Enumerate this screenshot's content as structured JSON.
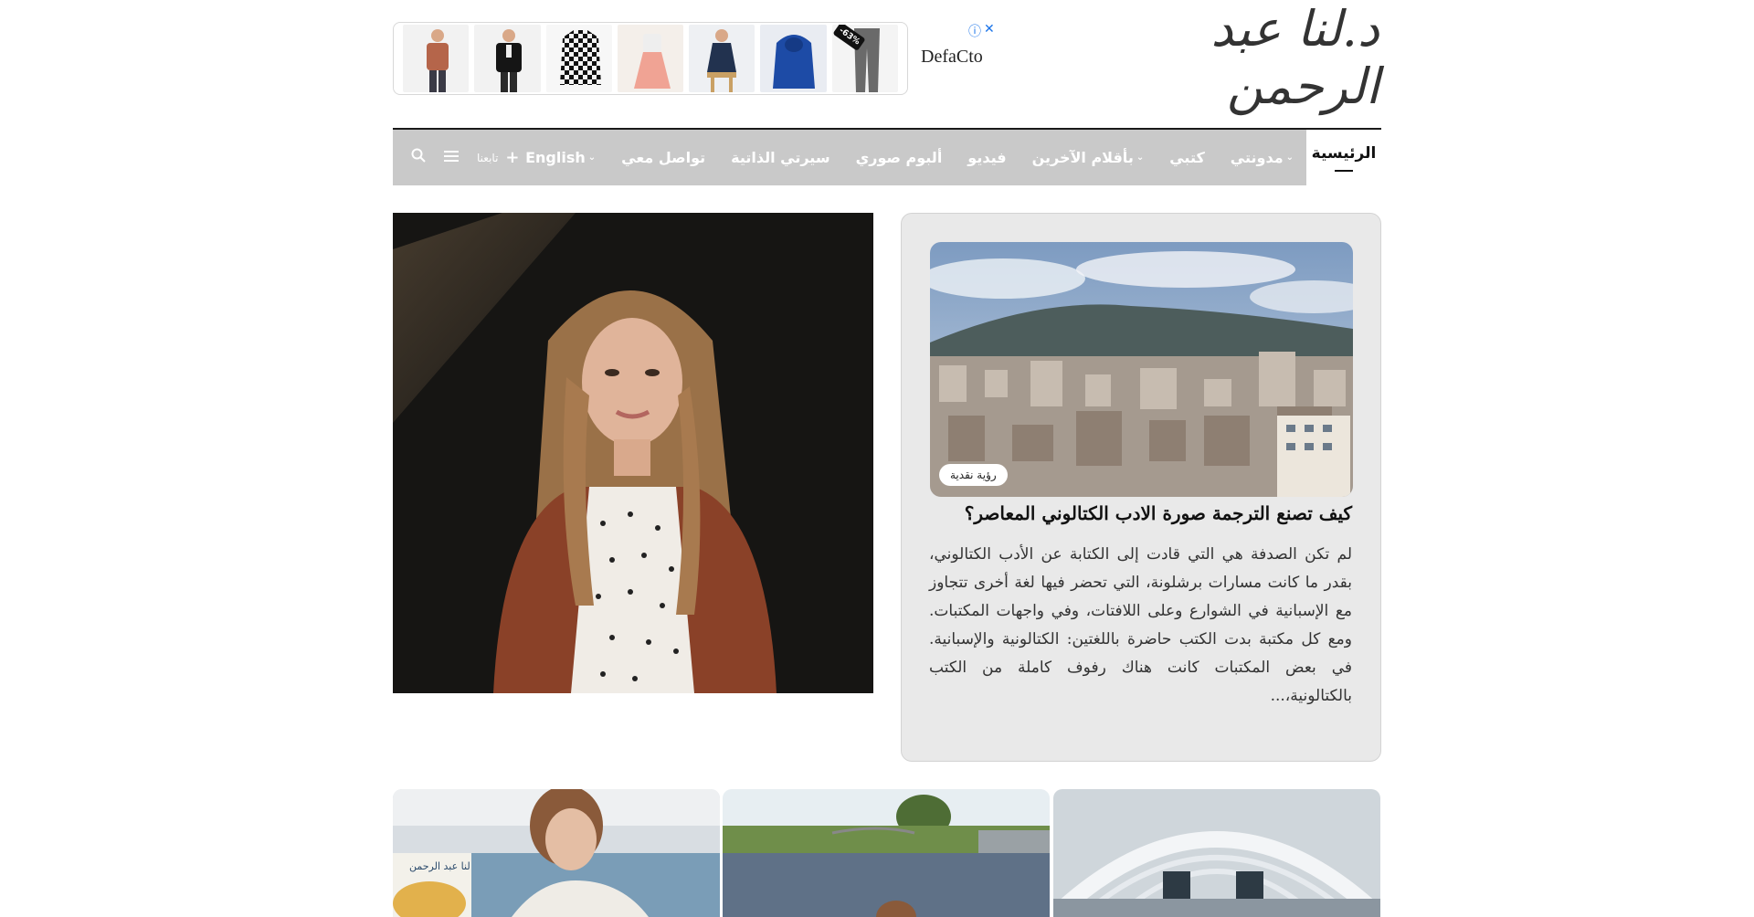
{
  "ad": {
    "brand": "DefaCto",
    "discount": "-63%",
    "info_icon": "info-icon",
    "close_icon": "close-icon"
  },
  "logo": {
    "text": "د.لنا عبد الرحمن"
  },
  "nav": {
    "active": "الرئيسية",
    "items": [
      {
        "label": "مدونتي",
        "dropdown": true
      },
      {
        "label": "كتبي",
        "dropdown": false
      },
      {
        "label": "بأقلام الآخرين",
        "dropdown": true
      },
      {
        "label": "فيديو",
        "dropdown": false
      },
      {
        "label": "ألبوم صوري",
        "dropdown": false
      },
      {
        "label": "سيرتي الذاتية",
        "dropdown": false
      },
      {
        "label": "تواصل معي",
        "dropdown": false
      },
      {
        "label": "English",
        "dropdown": true
      }
    ],
    "follow_label": "تابعنا",
    "menu_icon": "menu-icon",
    "search_icon": "search-icon"
  },
  "featured": {
    "badge": "رؤية نقدية",
    "title": "كيف تصنع الترجمة صورة الادب الكتالوني المعاصر؟",
    "excerpt": "لم تكن الصدفة هي التي قادت إلى الكتابة عن الأدب الكتالوني، بقدر ما كانت مسارات برشلونة، التي تحضر فيها لغة أخرى تتجاوز مع الإسبانية في الشوارع وعلى اللافتات، وفي واجهات المكتبات. ومع كل مكتبة بدت الكتب حاضرة باللغتين: الكتالونية والإسبانية. في بعض المكتبات كانت هناك رفوف كاملة من الكتب بالكتالونية،..."
  },
  "thumbs": {
    "first_caption": "لنا عبد الرحمن"
  },
  "colors": {
    "nav_bg": "#c9c9c9",
    "card_bg": "#e9e9e9",
    "nav_border": "#1a1a1a"
  }
}
